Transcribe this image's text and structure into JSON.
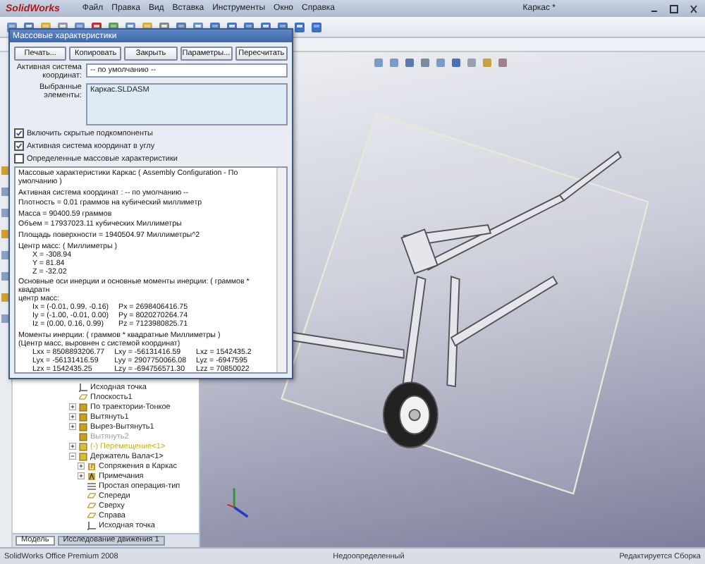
{
  "app": {
    "logo": "SolidWorks",
    "menu": [
      "Файл",
      "Правка",
      "Вид",
      "Вставка",
      "Инструменты",
      "Окно",
      "Справка"
    ],
    "window_title": "Каркас *"
  },
  "feature_tree": {
    "items": [
      {
        "label": "Исходная точка",
        "kind": "origin",
        "suppressed": false
      },
      {
        "label": "Плоскость1",
        "kind": "plane",
        "suppressed": false
      },
      {
        "label": "По траектории-Тонкое",
        "kind": "feature",
        "expanded": false,
        "suppressed": false
      },
      {
        "label": "Вытянуть1",
        "kind": "feature",
        "expanded": false,
        "suppressed": false
      },
      {
        "label": "Вырез-Вытянуть1",
        "kind": "feature",
        "expanded": false,
        "suppressed": false
      },
      {
        "label": "Вытянуть2",
        "kind": "feature",
        "suppressed": true
      },
      {
        "label": "(-) Перемещение<1>",
        "kind": "part",
        "expanded": false,
        "suppressed": false,
        "color": "#c8b400"
      },
      {
        "label": "Держатель Вала<1>",
        "kind": "part",
        "expanded": true,
        "suppressed": false,
        "children": [
          {
            "label": "Сопряжения в Каркас",
            "kind": "mates",
            "expanded": false,
            "suppressed": false
          },
          {
            "label": "Примечания",
            "kind": "notes",
            "expanded": false,
            "suppressed": false
          },
          {
            "label": "Простая операция-тип",
            "kind": "list",
            "suppressed": false
          },
          {
            "label": "Спереди",
            "kind": "plane",
            "suppressed": false
          },
          {
            "label": "Сверху",
            "kind": "plane",
            "suppressed": false
          },
          {
            "label": "Справа",
            "kind": "plane",
            "suppressed": false
          },
          {
            "label": "Исходная точка",
            "kind": "origin",
            "suppressed": false
          }
        ]
      }
    ],
    "tabs": [
      {
        "label": "Модель",
        "selected": true
      },
      {
        "label": "Исследование движения 1",
        "selected": false
      }
    ]
  },
  "dialog": {
    "title": "Массовые характеристики",
    "buttons": [
      "Печать...",
      "Копировать",
      "Закрыть",
      "Параметры...",
      "Пересчитать"
    ],
    "coord_label": "Активная система координат:",
    "coord_value": "-- по умолчанию --",
    "selected_label": "Выбранные элементы:",
    "selected_items": [
      "Каркас.SLDASM"
    ],
    "checkboxes": [
      {
        "label": "Включить скрытые подкомпоненты",
        "checked": true
      },
      {
        "label": "Активная система координат в углу",
        "checked": true
      },
      {
        "label": "Определенные массовые характеристики",
        "checked": false
      }
    ],
    "results": [
      {
        "kind": "line",
        "text": "Массовые характеристики Каркас ( Assembly Configuration - По умолчанию )"
      },
      {
        "kind": "line",
        "text": "Активная система координат : -- по умолчанию --"
      },
      {
        "kind": "line",
        "text": "Плотность = 0.01 граммов на кубический миллиметр"
      },
      {
        "kind": "line",
        "text": "Масса = 90400.59 граммов"
      },
      {
        "kind": "line",
        "text": "Объем = 17937023.11 кубических Миллиметры"
      },
      {
        "kind": "line",
        "text": "Площадь поверхности = 1940504.97 Миллиметры^2"
      },
      {
        "kind": "block",
        "lines": [
          "Центр масс: ( Миллиметры )"
        ],
        "rows": [
          [
            "X = -308.94"
          ],
          [
            "Y = 81.84"
          ],
          [
            "Z = -32.02"
          ]
        ]
      },
      {
        "kind": "block",
        "lines": [
          "Основные оси инерции и основные моменты инерции: ( граммов * квадратн",
          "центр масс:"
        ],
        "rows": [
          [
            "Ix = (-0.01, 0.99, -0.16)",
            "Px = 2698406416.75"
          ],
          [
            "Iy = (-1.00, -0.01, 0.00)",
            "Py = 8020270264.74"
          ],
          [
            "Iz = (0.00, 0.16, 0.99)",
            "Pz = 7123980825.71"
          ]
        ]
      },
      {
        "kind": "block",
        "lines": [
          "Моменты инерции: ( граммов * квадратные Миллиметры )",
          "(Центр масс, выровнен с системой координат)"
        ],
        "rows": [
          [
            "Lxx = 8508893206.77",
            "Lxy = -56131416.59",
            "Lxz = 1542435.2"
          ],
          [
            "Lyx = -56131416.59",
            "Lyy = 2907750066.08",
            "Lyz = -6947595"
          ],
          [
            "Lzx = 1542435.25",
            "Lzy = -694756571.30",
            "Lzz = 70850022"
          ]
        ]
      }
    ]
  },
  "status_bar": [
    "SolidWorks Office Premium 2008",
    "Недоопределенный",
    "Редактируется Сборка"
  ]
}
